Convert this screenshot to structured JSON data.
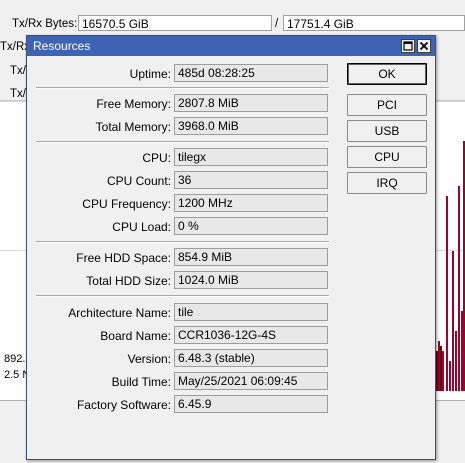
{
  "background": {
    "tx_rx_bytes_label": "Tx/Rx Bytes:",
    "tx_bytes_value": "16570.5 GiB",
    "separator": "/",
    "rx_bytes_value": "17751.4 GiB",
    "row2_label": "Tx/Rx",
    "row3_label": "Tx/",
    "row4_label": "Tx/",
    "graph_label_1": "892.",
    "graph_label_2": "2.5 N",
    "graph_bar_color": "#a0002a"
  },
  "dialog": {
    "title": "Resources",
    "restore_icon": "restore-icon",
    "close_icon": "close-icon",
    "title_color": "#3f63b4",
    "fields": {
      "uptime": {
        "label": "Uptime:",
        "value": "485d 08:28:25"
      },
      "free_memory": {
        "label": "Free Memory:",
        "value": "2807.8 MiB"
      },
      "total_memory": {
        "label": "Total Memory:",
        "value": "3968.0 MiB"
      },
      "cpu": {
        "label": "CPU:",
        "value": "tilegx"
      },
      "cpu_count": {
        "label": "CPU Count:",
        "value": "36"
      },
      "cpu_frequency": {
        "label": "CPU Frequency:",
        "value": "1200 MHz"
      },
      "cpu_load": {
        "label": "CPU Load:",
        "value": "0 %"
      },
      "free_hdd": {
        "label": "Free HDD Space:",
        "value": "854.9 MiB"
      },
      "total_hdd": {
        "label": "Total HDD Size:",
        "value": "1024.0 MiB"
      },
      "architecture": {
        "label": "Architecture Name:",
        "value": "tile"
      },
      "board_name": {
        "label": "Board Name:",
        "value": "CCR1036-12G-4S"
      },
      "version": {
        "label": "Version:",
        "value": "6.48.3 (stable)"
      },
      "build_time": {
        "label": "Build Time:",
        "value": "May/25/2021 06:09:45"
      },
      "factory_software": {
        "label": "Factory Software:",
        "value": "6.45.9"
      }
    },
    "buttons": {
      "ok": "OK",
      "pci": "PCI",
      "usb": "USB",
      "cpu": "CPU",
      "irq": "IRQ"
    }
  }
}
